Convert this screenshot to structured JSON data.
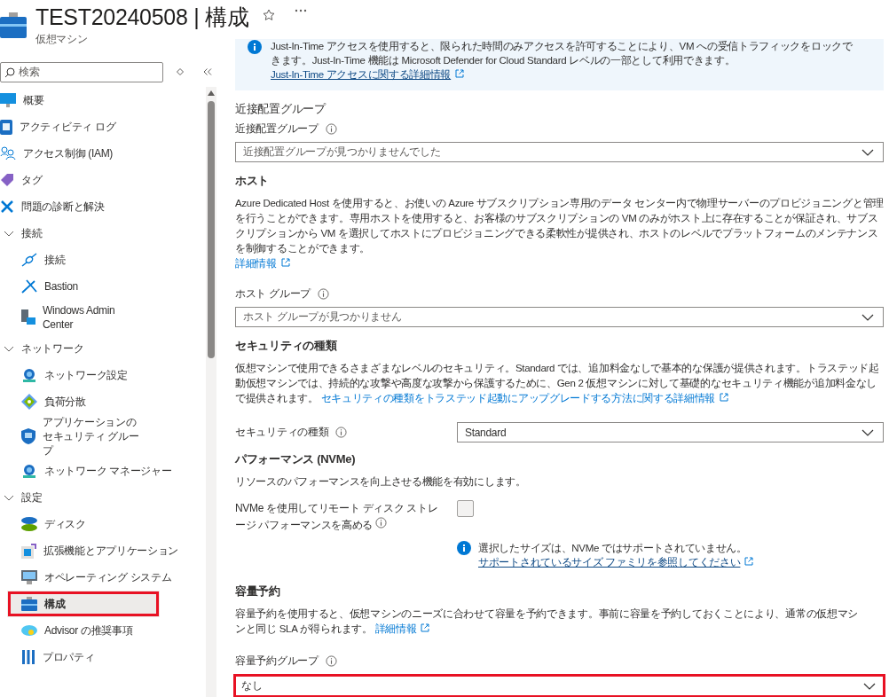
{
  "header": {
    "title": "TEST20240508 | 構成",
    "subtitle": "仮想マシン"
  },
  "search": {
    "placeholder": "検索"
  },
  "sidebar": {
    "items": [
      {
        "kind": "item",
        "label": "概要",
        "selected": false,
        "highlighted": false
      },
      {
        "kind": "item",
        "label": "アクティビティ ログ",
        "selected": false,
        "highlighted": false
      },
      {
        "kind": "item",
        "label": "アクセス制御 (IAM)",
        "selected": false,
        "highlighted": false
      },
      {
        "kind": "item",
        "label": "タグ",
        "selected": false,
        "highlighted": false
      },
      {
        "kind": "item",
        "label": "問題の診断と解決",
        "selected": false,
        "highlighted": false
      },
      {
        "kind": "group",
        "label": "接続",
        "expanded": true,
        "children": [
          {
            "kind": "item",
            "label": "接続",
            "selected": false,
            "highlighted": false
          },
          {
            "kind": "item",
            "label": "Bastion",
            "selected": false,
            "highlighted": false
          },
          {
            "kind": "item",
            "label": "Windows Admin Center",
            "selected": false,
            "highlighted": false
          }
        ]
      },
      {
        "kind": "group",
        "label": "ネットワーク",
        "expanded": true,
        "children": [
          {
            "kind": "item",
            "label": "ネットワーク設定",
            "selected": false,
            "highlighted": false
          },
          {
            "kind": "item",
            "label": "負荷分散",
            "selected": false,
            "highlighted": false
          },
          {
            "kind": "item",
            "label": "アプリケーションのセキュリティ グループ",
            "selected": false,
            "highlighted": false
          },
          {
            "kind": "item",
            "label": "ネットワーク マネージャー",
            "selected": false,
            "highlighted": false
          }
        ]
      },
      {
        "kind": "group",
        "label": "設定",
        "expanded": true,
        "children": [
          {
            "kind": "item",
            "label": "ディスク",
            "selected": false,
            "highlighted": false
          },
          {
            "kind": "item",
            "label": "拡張機能とアプリケーション",
            "selected": false,
            "highlighted": false
          },
          {
            "kind": "item",
            "label": "オペレーティング システム",
            "selected": false,
            "highlighted": false
          },
          {
            "kind": "item",
            "label": "構成",
            "selected": true,
            "highlighted": true
          },
          {
            "kind": "item",
            "label": "Advisor の推奨事項",
            "selected": false,
            "highlighted": false
          },
          {
            "kind": "item",
            "label": "プロパティ",
            "selected": false,
            "highlighted": false
          }
        ]
      }
    ]
  },
  "banner": {
    "text": "Just-In-Time アクセスを使用すると、限られた時間のみアクセスを許可することにより、VM への受信トラフィックをロックできます。Just-In-Time 機能は Microsoft Defender for Cloud Standard レベルの一部として利用できます。",
    "link": "Just-In-Time アクセスに関する詳細情報"
  },
  "proximity": {
    "heading": "近接配置グループ",
    "label": "近接配置グループ",
    "dropdown": {
      "value": "近接配置グループが見つかりませんでした",
      "disabled": true,
      "highlighted": false
    }
  },
  "host": {
    "heading": "ホスト",
    "description": "Azure Dedicated Host を使用すると、お使いの Azure サブスクリプション専用のデータ センター内で物理サーバーのプロビジョニングと管理を行うことができます。専用ホストを使用すると、お客様のサブスクリプションの VM のみがホスト上に存在することが保証され、サブスクリプションから VM を選択してホストにプロビジョニングできる柔軟性が提供され、ホストのレベルでプラットフォームのメンテナンスを制御することができます。",
    "link": "詳細情報",
    "label": "ホスト グループ",
    "dropdown": {
      "value": "ホスト グループが見つかりません",
      "disabled": true,
      "highlighted": false
    }
  },
  "security": {
    "heading": "セキュリティの種類",
    "description": "仮想マシンで使用できるさまざまなレベルのセキュリティ。Standard では、追加料金なしで基本的な保護が提供されます。トラステッド起動仮想マシンでは、持続的な攻撃や高度な攻撃から保護するために、Gen 2 仮想マシンに対して基礎的なセキュリティ機能が追加料金なしで提供されます。",
    "link": "セキュリティの種類をトラステッド起動にアップグレードする方法に関する詳細情報",
    "label": "セキュリティの種類",
    "dropdown": {
      "value": "Standard",
      "disabled": false,
      "highlighted": false
    }
  },
  "performance": {
    "heading": "パフォーマンス (NVMe)",
    "description": "リソースのパフォーマンスを向上させる機能を有効にします。",
    "label": "NVMe を使用してリモート ディスク ストレージ パフォーマンスを高める",
    "checked": false,
    "notice": "選択したサイズは、NVMe ではサポートされていません。",
    "notice_link": "サポートされているサイズ ファミリを参照してください"
  },
  "capacity": {
    "heading": "容量予約",
    "description": "容量予約を使用すると、仮想マシンのニーズに合わせて容量を予約できます。事前に容量を予約しておくことにより、通常の仮想マシンと同じ SLA が得られます。",
    "link": "詳細情報",
    "label": "容量予約グループ",
    "dropdown": {
      "value": "なし",
      "disabled": false,
      "highlighted": true
    }
  }
}
